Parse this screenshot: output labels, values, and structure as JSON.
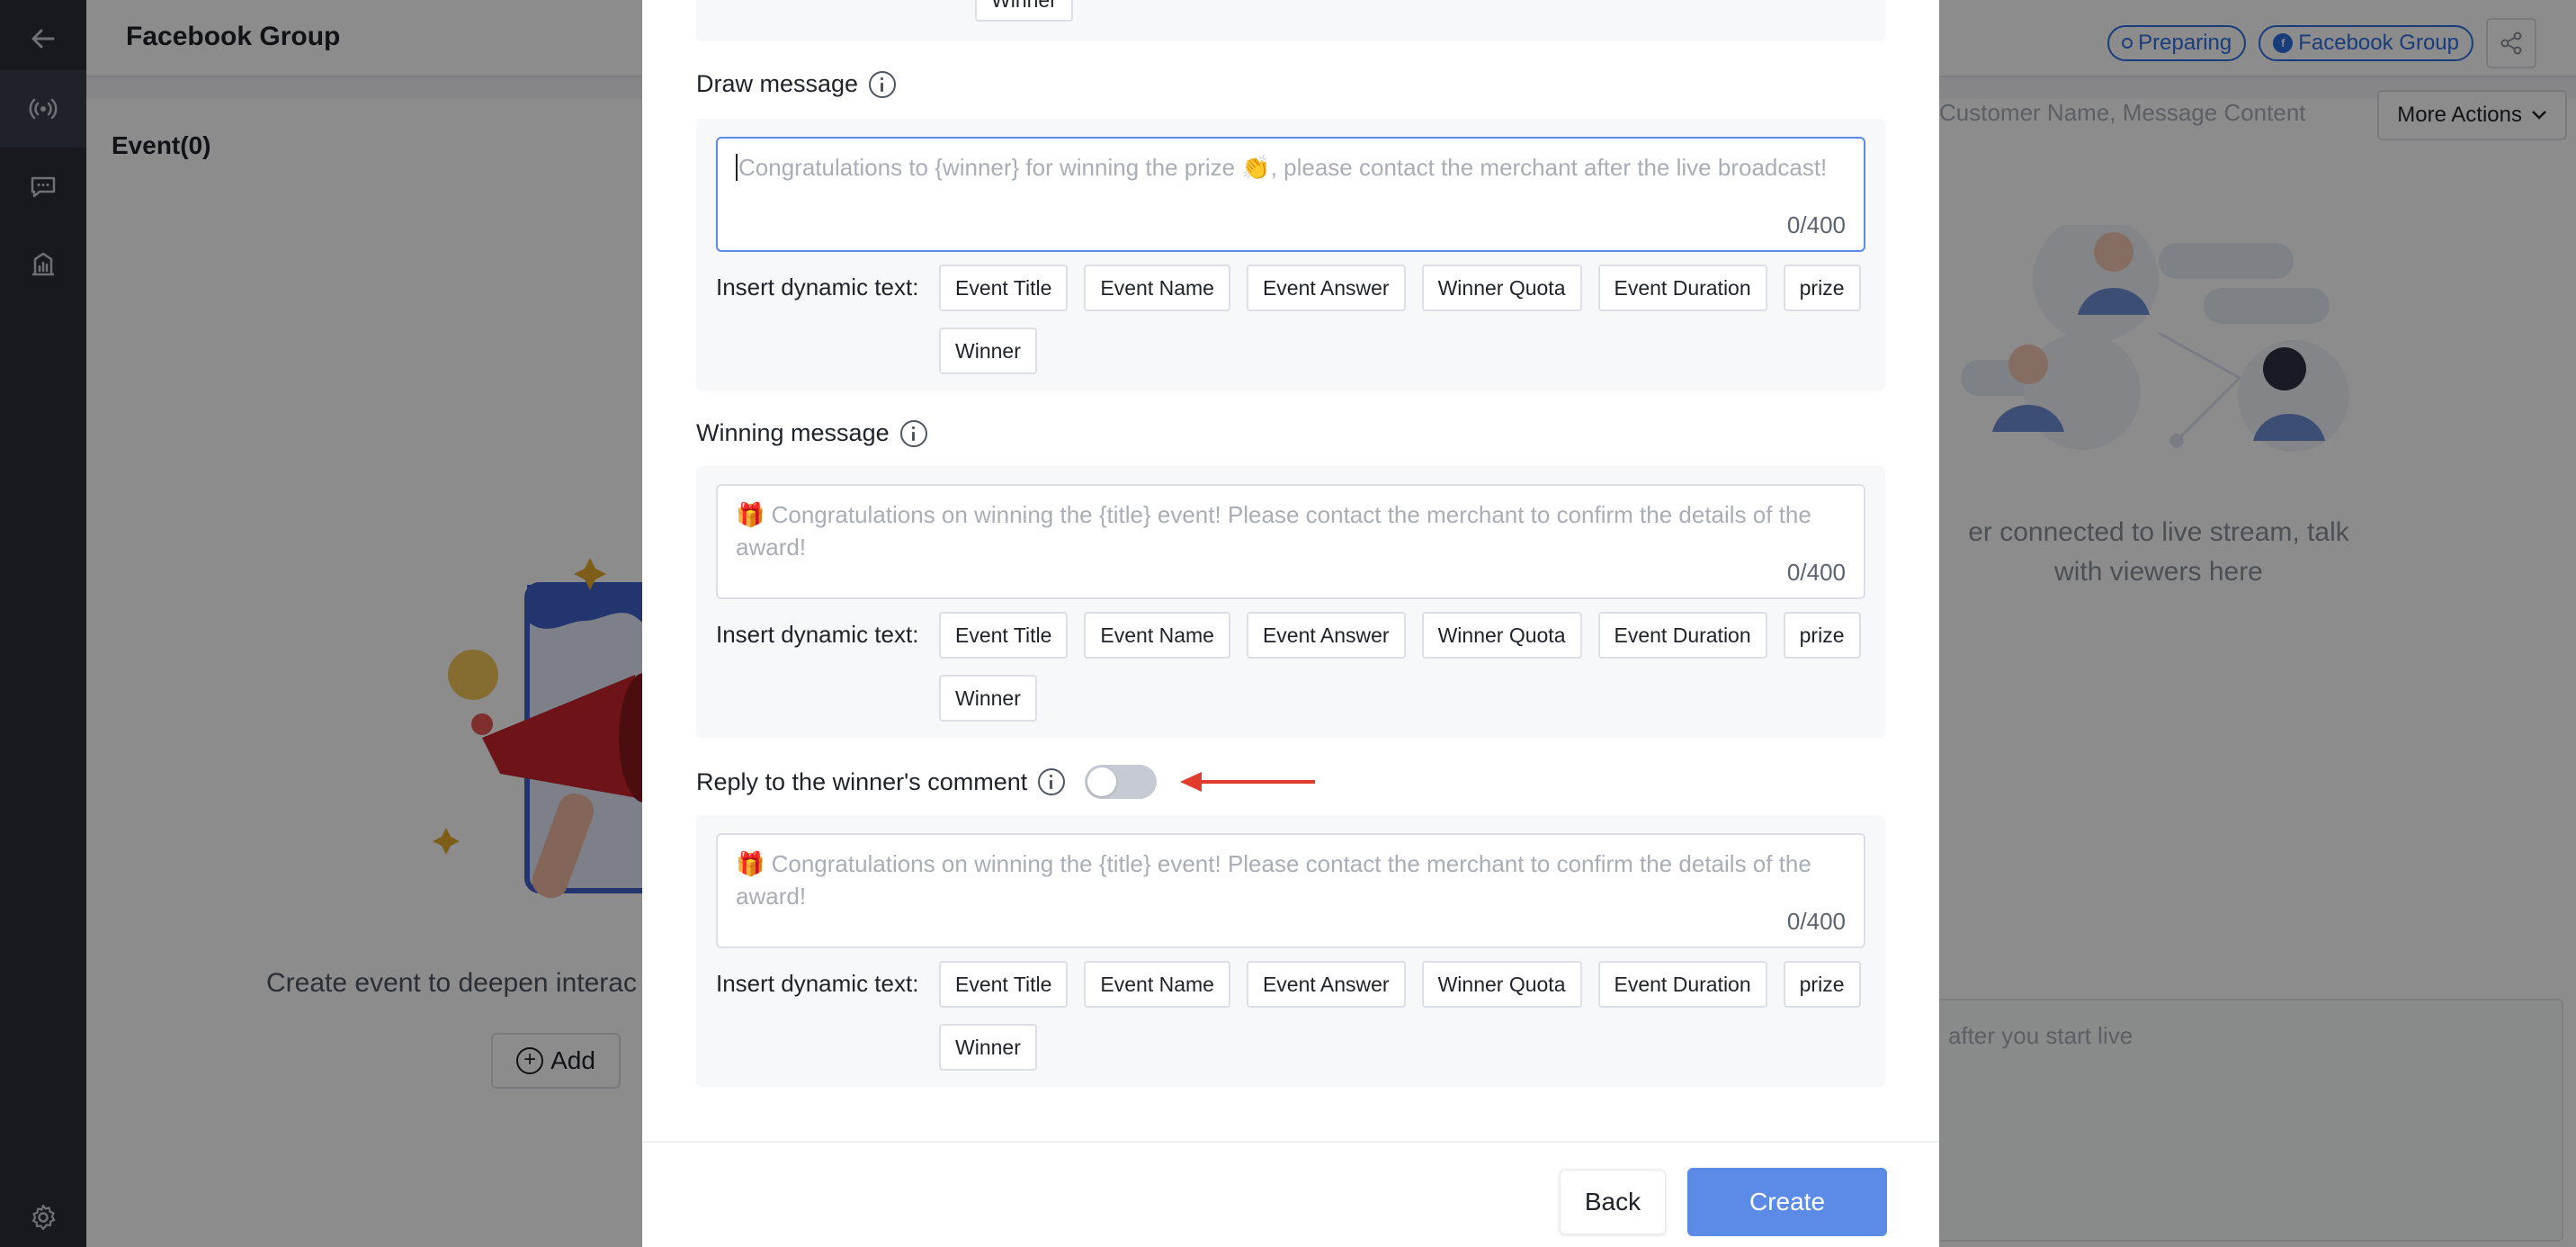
{
  "app": {
    "title": "Facebook Group",
    "status_badge": "Preparing",
    "platform_badge": "Facebook Group"
  },
  "left_panel": {
    "tab_label": "Event(0)",
    "empty_text": "Create event to deepen interac",
    "add_button": "Add"
  },
  "right_panel": {
    "search_placeholder": "Customer Name, Message Content",
    "more_actions": "More Actions",
    "empty_text_line1": "er connected to live stream, talk",
    "empty_text_line2": "with viewers here",
    "chat_placeholder": "after you start live"
  },
  "modal": {
    "top_tag": "Winner",
    "draw_message": {
      "label": "Draw message",
      "placeholder": "Congratulations to {winner} for winning the prize 👏, please contact the merchant after the live broadcast!",
      "counter": "0/400"
    },
    "winning_message": {
      "label": "Winning message",
      "placeholder": "🎁 Congratulations on winning the {title}  event! Please contact the merchant to confirm the details of the award!",
      "counter": "0/400"
    },
    "reply_comment": {
      "label": "Reply to the winner's comment",
      "toggle_on": false,
      "placeholder": "🎁 Congratulations on winning the {title}  event! Please contact the merchant to confirm the details of the award!",
      "counter": "0/400"
    },
    "dynamic_label": "Insert dynamic text:",
    "dynamic_tags": [
      "Event Title",
      "Event Name",
      "Event Answer",
      "Winner Quota",
      "Event Duration",
      "prize",
      "Winner"
    ],
    "back_button": "Back",
    "create_button": "Create"
  },
  "colors": {
    "primary": "#5b8be6",
    "annotation_arrow": "#e03b2c",
    "nav_bg": "#2a2e38"
  },
  "icons": {
    "back": "arrow-left-icon",
    "live": "broadcast-icon",
    "chat": "chat-bubble-icon",
    "stats": "building-chart-icon",
    "settings": "gear-icon",
    "share": "share-icon",
    "info": "info-icon"
  }
}
